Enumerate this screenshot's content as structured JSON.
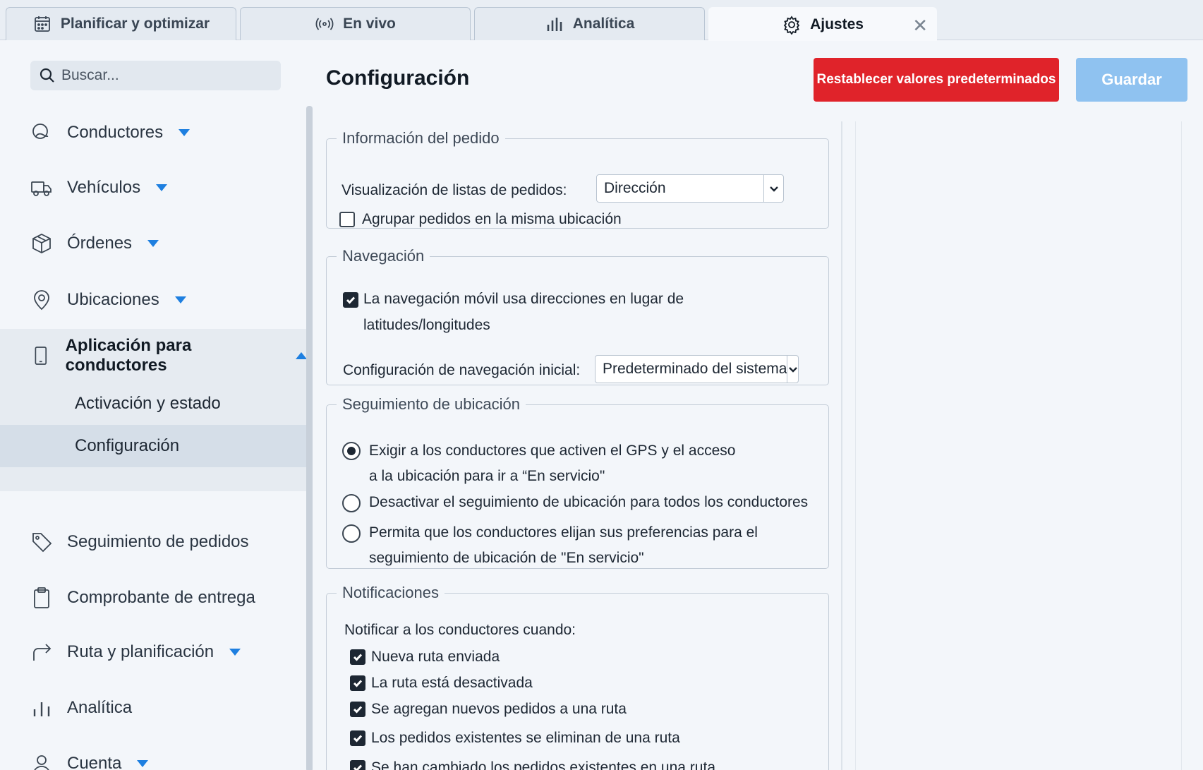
{
  "tabs": [
    {
      "label": "Planificar y optimizar",
      "icon": "calendar-icon"
    },
    {
      "label": "En vivo",
      "icon": "broadcast-icon"
    },
    {
      "label": "Analítica",
      "icon": "bar-chart-icon"
    },
    {
      "label": "Ajustes",
      "icon": "gear-icon",
      "active": true
    }
  ],
  "search": {
    "placeholder": "Buscar..."
  },
  "sidebar": {
    "items": [
      {
        "label": "Conductores",
        "icon": "drivers-icon"
      },
      {
        "label": "Vehículos",
        "icon": "truck-icon"
      },
      {
        "label": "Órdenes",
        "icon": "box-icon"
      },
      {
        "label": "Ubicaciones",
        "icon": "location-pin-icon"
      },
      {
        "label": "Aplicación para conductores",
        "icon": "phone-icon"
      },
      {
        "label": "Seguimiento de pedidos",
        "icon": "tag-icon"
      },
      {
        "label": "Comprobante de entrega",
        "icon": "clipboard-icon"
      },
      {
        "label": "Ruta y planificación",
        "icon": "route-arrow-icon"
      },
      {
        "label": "Analítica",
        "icon": "bar-chart-icon"
      },
      {
        "label": "Cuenta",
        "icon": "user-icon"
      }
    ],
    "sub_items": [
      {
        "label": "Activación y estado"
      },
      {
        "label": "Configuración",
        "selected": true
      }
    ]
  },
  "main": {
    "title": "Configuración",
    "reset_label": "Restablecer valores predeterminados",
    "save_label": "Guardar"
  },
  "order_info": {
    "legend": "Información del pedido",
    "display_label": "Visualización de listas de pedidos:",
    "display_value": "Dirección",
    "group_label": "Agrupar pedidos en la misma ubicación",
    "group_checked": false
  },
  "navigation": {
    "legend": "Navegación",
    "mobile_line1": "La navegación móvil usa direcciones en lugar de",
    "mobile_line2": "latitudes/longitudes",
    "mobile_checked": true,
    "initial_label": "Configuración de navegación inicial:",
    "initial_value": "Predeterminado del sistema"
  },
  "tracking": {
    "legend": "Seguimiento de ubicación",
    "opt1_line1": "Exigir a los conductores que activen el GPS y el acceso",
    "opt1_line2": "a la ubicación para ir a “En servicio\"",
    "opt2_line1": "Desactivar el seguimiento de ubicación para todos los conductores",
    "opt3_line1": "Permita que los conductores elijan sus preferencias para el",
    "opt3_line2": "seguimiento de ubicación de \"En servicio\"",
    "selected": 1
  },
  "notifications": {
    "legend": "Notificaciones",
    "intro": "Notificar a los conductores cuando:",
    "items": [
      {
        "label": "Nueva ruta enviada",
        "checked": true
      },
      {
        "label": "La ruta está desactivada",
        "checked": true
      },
      {
        "label": "Se agregan nuevos pedidos a una ruta",
        "checked": true
      },
      {
        "label": "Los pedidos existentes se eliminan de una ruta",
        "checked": true
      },
      {
        "label": "Se han cambiado los pedidos existentes en una ruta",
        "checked": true
      }
    ]
  }
}
